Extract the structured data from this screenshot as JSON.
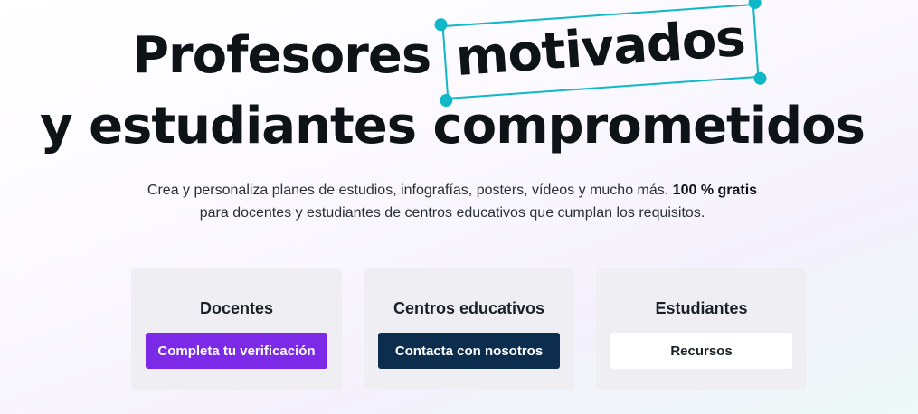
{
  "hero": {
    "title_line1": "Profesores",
    "title_highlight": "motivados",
    "title_line2": "y estudiantes comprometidos",
    "subtitle_text": "Crea y personaliza planes de estudios, infografías, posters, vídeos y mucho más.",
    "subtitle_bold": "100 % gratis",
    "subtitle_line2": "para docentes y estudiantes de centros educativos que cumplan los requisitos.",
    "highlight_color": "#10b7c7"
  },
  "cards": [
    {
      "title": "Docentes",
      "button_label": "Completa tu verificación",
      "button_color": "#7d2ae8"
    },
    {
      "title": "Centros educativos",
      "button_label": "Contacta con nosotros",
      "button_color": "#0d2d4f"
    },
    {
      "title": "Estudiantes",
      "button_label": "Recursos",
      "button_color": "#ffffff"
    }
  ]
}
